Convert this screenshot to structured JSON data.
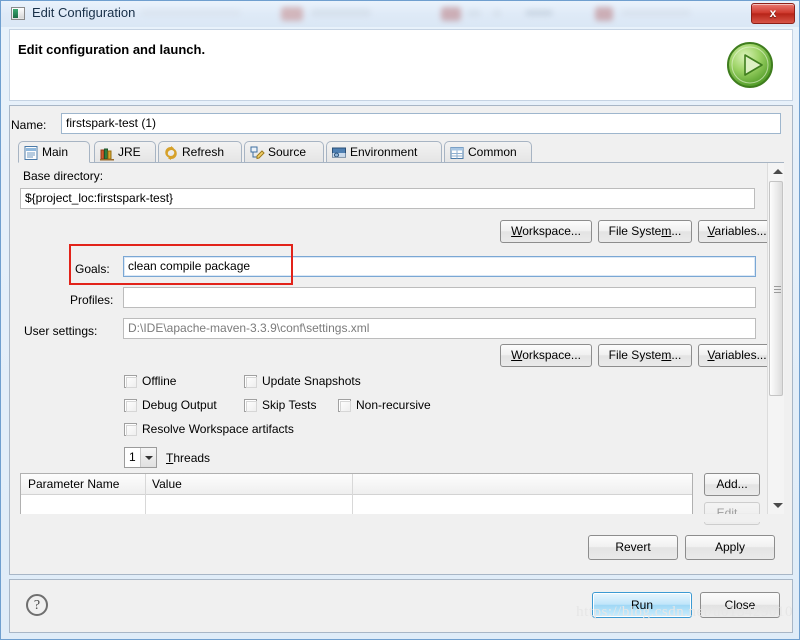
{
  "window": {
    "title": "Edit Configuration",
    "title_icon": "eclipse-config-icon",
    "close_label": "x"
  },
  "header": {
    "title": "Edit configuration and launch.",
    "run_icon": "green-run-play-icon"
  },
  "name_field": {
    "label": "Name:",
    "value": "firstspark-test (1)"
  },
  "tabs": [
    {
      "label": "Main",
      "icon": "main-document-icon",
      "active": true
    },
    {
      "label": "JRE",
      "icon": "jre-library-icon",
      "active": false
    },
    {
      "label": "Refresh",
      "icon": "refresh-arrows-icon",
      "active": false
    },
    {
      "label": "Source",
      "icon": "source-pencil-icon",
      "active": false
    },
    {
      "label": "Environment",
      "icon": "environment-icon",
      "active": false
    },
    {
      "label": "Common",
      "icon": "common-table-icon",
      "active": false
    }
  ],
  "main_tab": {
    "base_directory": {
      "label": "Base directory:",
      "value": "${project_loc:firstspark-test}"
    },
    "browse_buttons_top": [
      {
        "label": "Workspace...",
        "mnemonic": "W"
      },
      {
        "label": "File System...",
        "mnemonic": "m"
      },
      {
        "label": "Variables...",
        "mnemonic": "V"
      }
    ],
    "goals": {
      "label": "Goals:",
      "value": "clean compile package",
      "focused": true,
      "annotated": true
    },
    "profiles": {
      "label": "Profiles:",
      "value": ""
    },
    "user_settings": {
      "label": "User settings:",
      "value": "D:\\IDE\\apache-maven-3.3.9\\conf\\settings.xml"
    },
    "browse_buttons_bottom": [
      {
        "label": "Workspace...",
        "mnemonic": "W"
      },
      {
        "label": "File System...",
        "mnemonic": "m"
      },
      {
        "label": "Variables...",
        "mnemonic": "V"
      }
    ],
    "checkboxes": [
      {
        "label": "Offline",
        "checked": false
      },
      {
        "label": "Update Snapshots",
        "checked": false
      },
      {
        "label": "Debug Output",
        "checked": false
      },
      {
        "label": "Skip Tests",
        "checked": false
      },
      {
        "label": "Non-recursive",
        "checked": false
      },
      {
        "label": "Resolve Workspace artifacts",
        "checked": false
      }
    ],
    "threads": {
      "value": "1",
      "label": "Threads",
      "options": [
        "1"
      ]
    },
    "parameters_table": {
      "columns": [
        "Parameter Name",
        "Value"
      ],
      "rows": [],
      "buttons": [
        {
          "label": "Add..."
        },
        {
          "label": "Edit..."
        }
      ]
    }
  },
  "actions": {
    "revert": "Revert",
    "apply": "Apply",
    "run": "Run",
    "close": "Close",
    "help": "?"
  },
  "watermark": "https://blog.csdn.net/u013429010",
  "colors": {
    "accent": "#3c9ad3",
    "annotation": "#e2231a",
    "titlebar": "#dfeaf7",
    "panel": "#f0f0f0"
  }
}
